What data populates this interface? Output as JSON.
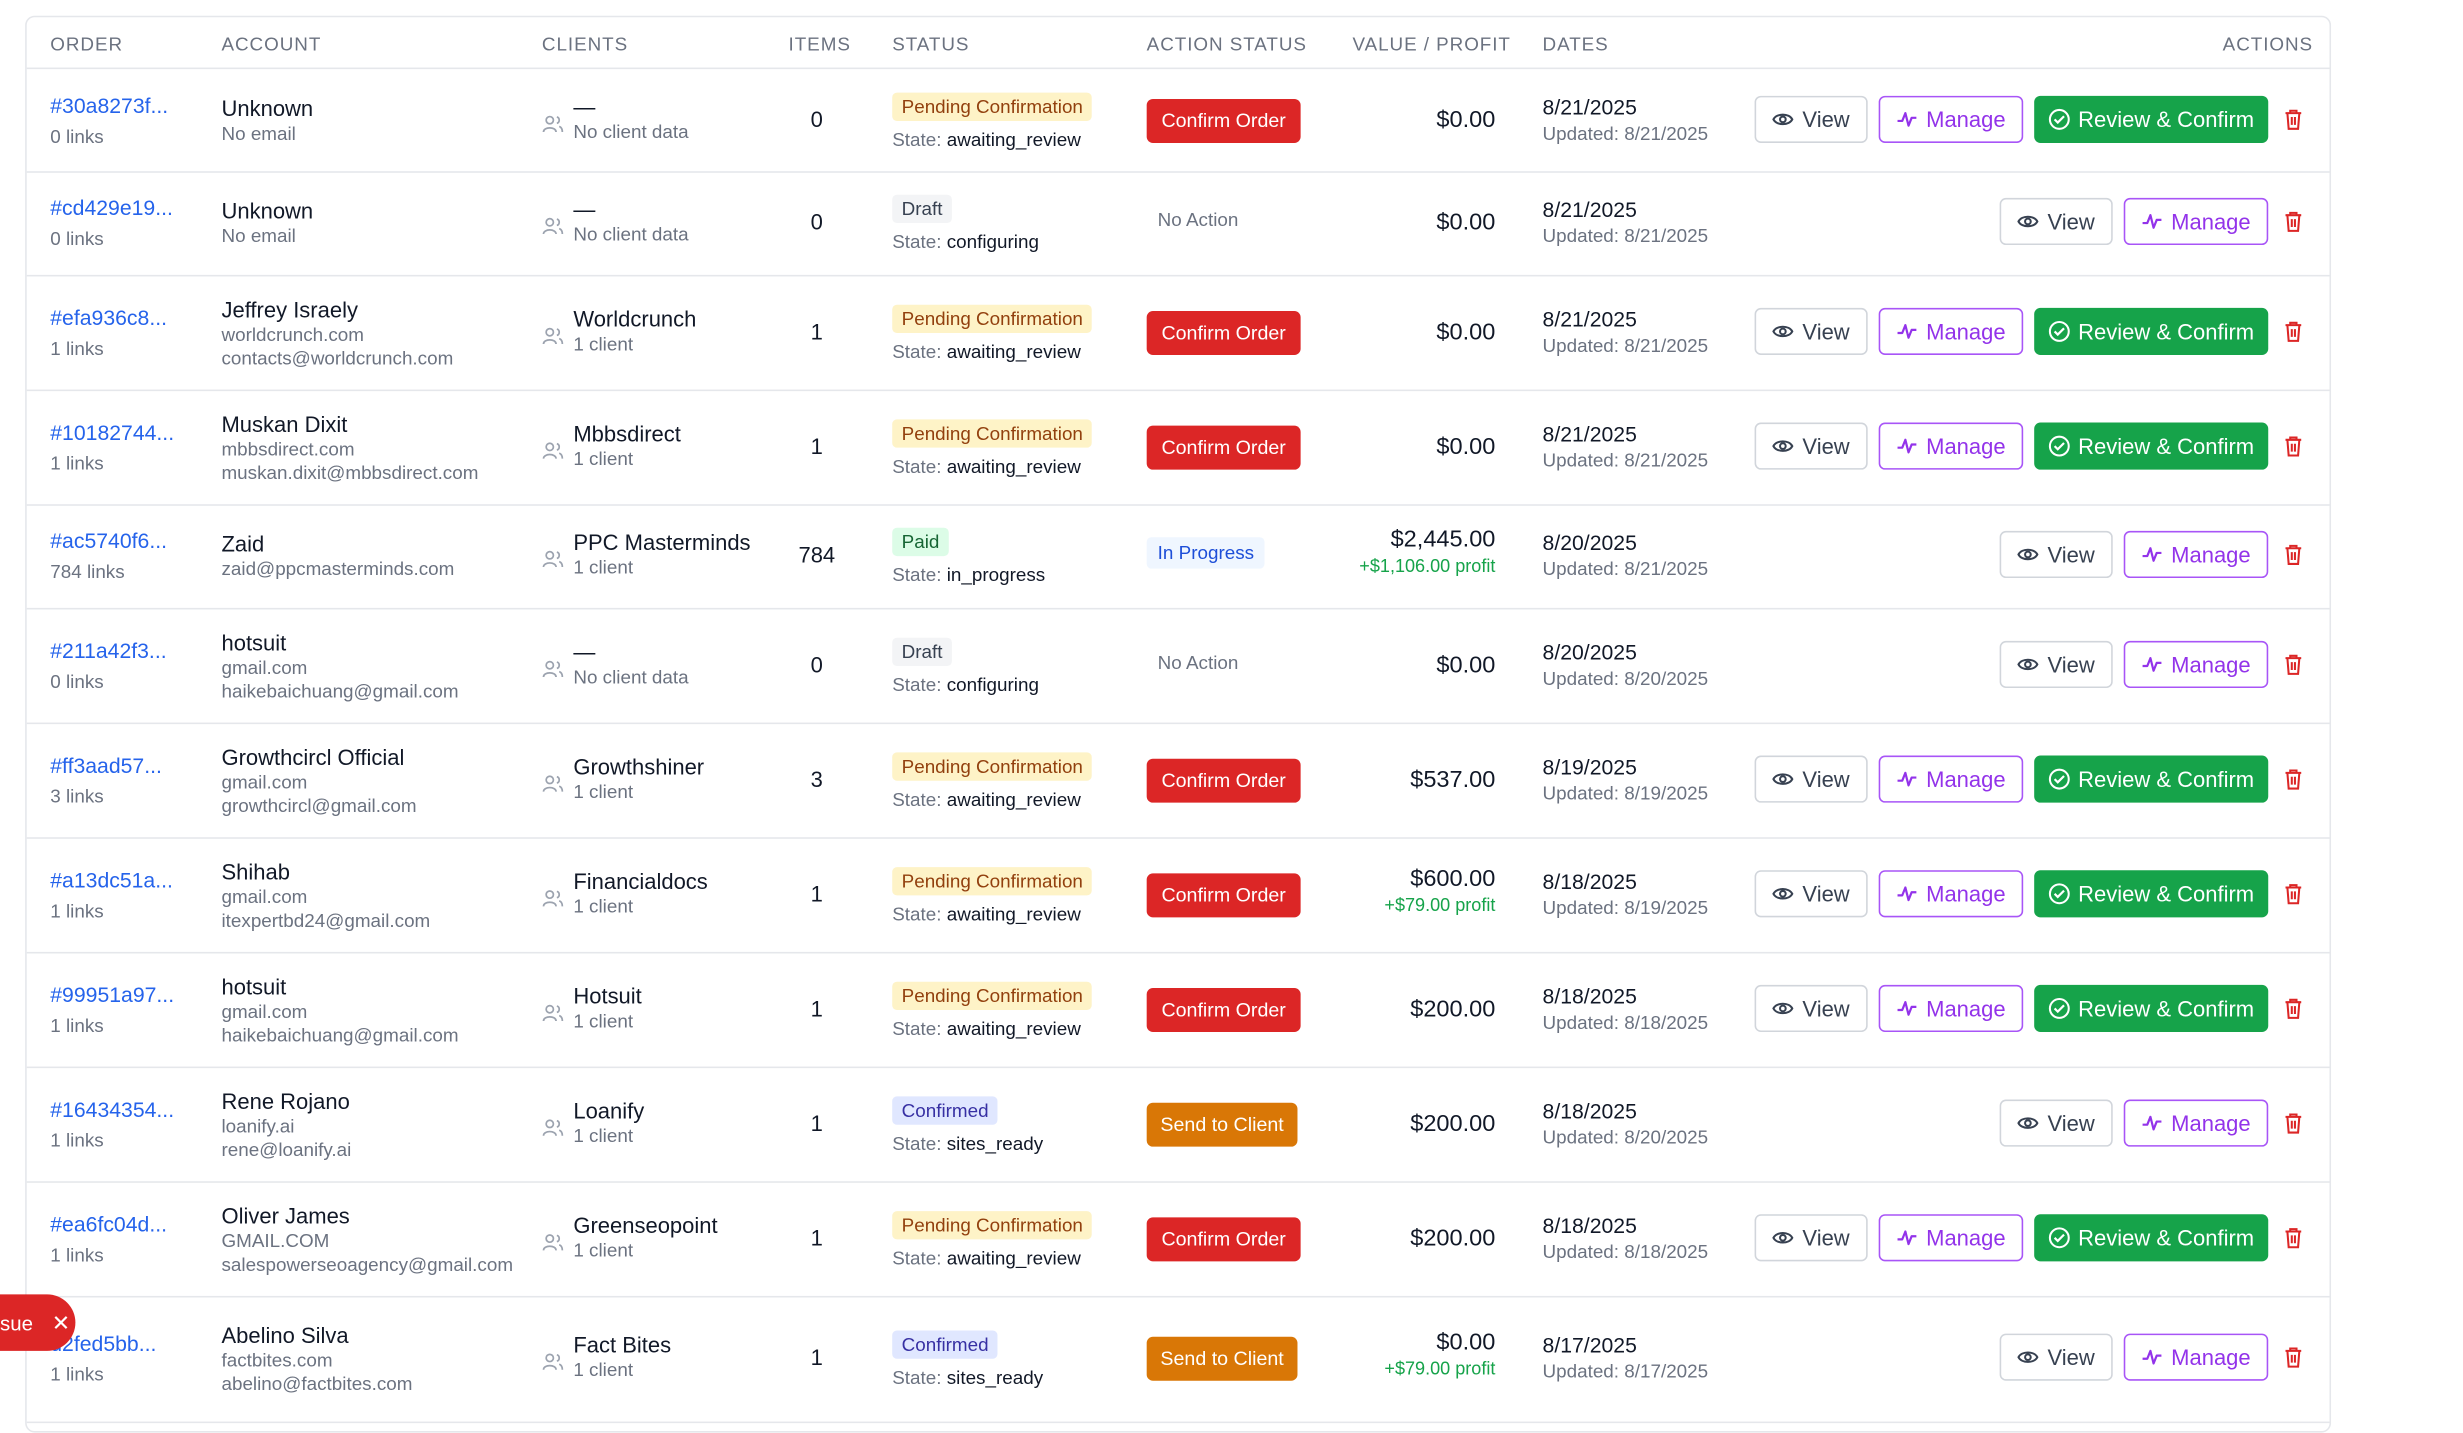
{
  "headers": {
    "order": "ORDER",
    "account": "ACCOUNT",
    "clients": "CLIENTS",
    "items": "ITEMS",
    "status": "STATUS",
    "action_status": "ACTION STATUS",
    "value_profit": "VALUE / PROFIT",
    "dates": "DATES",
    "actions": "ACTIONS"
  },
  "labels": {
    "view": "View",
    "manage": "Manage",
    "review": "Review & Confirm",
    "state_prefix": "State:"
  },
  "toast": {
    "text": "sue",
    "close": "✕"
  },
  "colors": {
    "link": "#2563eb",
    "danger": "#dc2626",
    "success": "#16a34a",
    "warning": "#d97706",
    "manage": "#9333ea"
  },
  "rows": [
    {
      "order_id": "#30a8273f...",
      "links": "0 links",
      "account_name": "Unknown",
      "account_lines": [
        "No email"
      ],
      "client_name": "—",
      "client_sub": "No client data",
      "items": "0",
      "status": "Pending Confirmation",
      "status_kind": "pending",
      "state": "awaiting_review",
      "action": "Confirm Order",
      "action_kind": "confirm",
      "value": "$0.00",
      "profit": "",
      "date": "8/21/2025",
      "updated": "Updated: 8/21/2025",
      "show_review": true
    },
    {
      "order_id": "#cd429e19...",
      "links": "0 links",
      "account_name": "Unknown",
      "account_lines": [
        "No email"
      ],
      "client_name": "—",
      "client_sub": "No client data",
      "items": "0",
      "status": "Draft",
      "status_kind": "draft",
      "state": "configuring",
      "action": "No Action",
      "action_kind": "none",
      "value": "$0.00",
      "profit": "",
      "date": "8/21/2025",
      "updated": "Updated: 8/21/2025",
      "show_review": false
    },
    {
      "order_id": "#efa936c8...",
      "links": "1 links",
      "account_name": "Jeffrey Israely",
      "account_lines": [
        "worldcrunch.com",
        "contacts@worldcrunch.com"
      ],
      "client_name": "Worldcrunch",
      "client_sub": "1 client",
      "items": "1",
      "status": "Pending Confirmation",
      "status_kind": "pending",
      "state": "awaiting_review",
      "action": "Confirm Order",
      "action_kind": "confirm",
      "value": "$0.00",
      "profit": "",
      "date": "8/21/2025",
      "updated": "Updated: 8/21/2025",
      "show_review": true
    },
    {
      "order_id": "#10182744...",
      "links": "1 links",
      "account_name": "Muskan Dixit",
      "account_lines": [
        "mbbsdirect.com",
        "muskan.dixit@mbbsdirect.com"
      ],
      "client_name": "Mbbsdirect",
      "client_sub": "1 client",
      "items": "1",
      "status": "Pending Confirmation",
      "status_kind": "pending",
      "state": "awaiting_review",
      "action": "Confirm Order",
      "action_kind": "confirm",
      "value": "$0.00",
      "profit": "",
      "date": "8/21/2025",
      "updated": "Updated: 8/21/2025",
      "show_review": true
    },
    {
      "order_id": "#ac5740f6...",
      "links": "784 links",
      "account_name": "Zaid",
      "account_lines": [
        "zaid@ppcmasterminds.com"
      ],
      "client_name": "PPC Masterminds",
      "client_sub": "1 client",
      "items": "784",
      "status": "Paid",
      "status_kind": "paid",
      "state": "in_progress",
      "action": "In Progress",
      "action_kind": "progress",
      "value": "$2,445.00",
      "profit": "+$1,106.00 profit",
      "date": "8/20/2025",
      "updated": "Updated: 8/21/2025",
      "show_review": false
    },
    {
      "order_id": "#211a42f3...",
      "links": "0 links",
      "account_name": "hotsuit",
      "account_lines": [
        "gmail.com",
        "haikebaichuang@gmail.com"
      ],
      "client_name": "—",
      "client_sub": "No client data",
      "items": "0",
      "status": "Draft",
      "status_kind": "draft",
      "state": "configuring",
      "action": "No Action",
      "action_kind": "none",
      "value": "$0.00",
      "profit": "",
      "date": "8/20/2025",
      "updated": "Updated: 8/20/2025",
      "show_review": false
    },
    {
      "order_id": "#ff3aad57...",
      "links": "3 links",
      "account_name": "Growthcircl Official",
      "account_lines": [
        "gmail.com",
        "growthcircl@gmail.com"
      ],
      "client_name": "Growthshiner",
      "client_sub": "1 client",
      "items": "3",
      "status": "Pending Confirmation",
      "status_kind": "pending",
      "state": "awaiting_review",
      "action": "Confirm Order",
      "action_kind": "confirm",
      "value": "$537.00",
      "profit": "",
      "date": "8/19/2025",
      "updated": "Updated: 8/19/2025",
      "show_review": true
    },
    {
      "order_id": "#a13dc51a...",
      "links": "1 links",
      "account_name": "Shihab",
      "account_lines": [
        "gmail.com",
        "itexpertbd24@gmail.com"
      ],
      "client_name": "Financialdocs",
      "client_sub": "1 client",
      "items": "1",
      "status": "Pending Confirmation",
      "status_kind": "pending",
      "state": "awaiting_review",
      "action": "Confirm Order",
      "action_kind": "confirm",
      "value": "$600.00",
      "profit": "+$79.00 profit",
      "date": "8/18/2025",
      "updated": "Updated: 8/19/2025",
      "show_review": true
    },
    {
      "order_id": "#99951a97...",
      "links": "1 links",
      "account_name": "hotsuit",
      "account_lines": [
        "gmail.com",
        "haikebaichuang@gmail.com"
      ],
      "client_name": "Hotsuit",
      "client_sub": "1 client",
      "items": "1",
      "status": "Pending Confirmation",
      "status_kind": "pending",
      "state": "awaiting_review",
      "action": "Confirm Order",
      "action_kind": "confirm",
      "value": "$200.00",
      "profit": "",
      "date": "8/18/2025",
      "updated": "Updated: 8/18/2025",
      "show_review": true
    },
    {
      "order_id": "#16434354...",
      "links": "1 links",
      "account_name": "Rene Rojano",
      "account_lines": [
        "loanify.ai",
        "rene@loanify.ai"
      ],
      "client_name": "Loanify",
      "client_sub": "1 client",
      "items": "1",
      "status": "Confirmed",
      "status_kind": "confirmed",
      "state": "sites_ready",
      "action": "Send to Client",
      "action_kind": "send",
      "value": "$200.00",
      "profit": "",
      "date": "8/18/2025",
      "updated": "Updated: 8/20/2025",
      "show_review": false
    },
    {
      "order_id": "#ea6fc04d...",
      "links": "1 links",
      "account_name": "Oliver James",
      "account_lines": [
        "GMAIL.COM",
        "salespowerseoagency@gmail.com"
      ],
      "client_name": "Greenseopoint",
      "client_sub": "1 client",
      "items": "1",
      "status": "Pending Confirmation",
      "status_kind": "pending",
      "state": "awaiting_review",
      "action": "Confirm Order",
      "action_kind": "confirm",
      "value": "$200.00",
      "profit": "",
      "date": "8/18/2025",
      "updated": "Updated: 8/18/2025",
      "show_review": true
    },
    {
      "order_id": "d2fed5bb...",
      "links": "1 links",
      "account_name": "Abelino Silva",
      "account_lines": [
        "factbites.com",
        "abelino@factbites.com"
      ],
      "client_name": "Fact Bites",
      "client_sub": "1 client",
      "items": "1",
      "status": "Confirmed",
      "status_kind": "confirmed",
      "state": "sites_ready",
      "action": "Send to Client",
      "action_kind": "send",
      "value": "$0.00",
      "profit": "+$79.00 profit",
      "date": "8/17/2025",
      "updated": "Updated: 8/17/2025",
      "show_review": false
    }
  ]
}
